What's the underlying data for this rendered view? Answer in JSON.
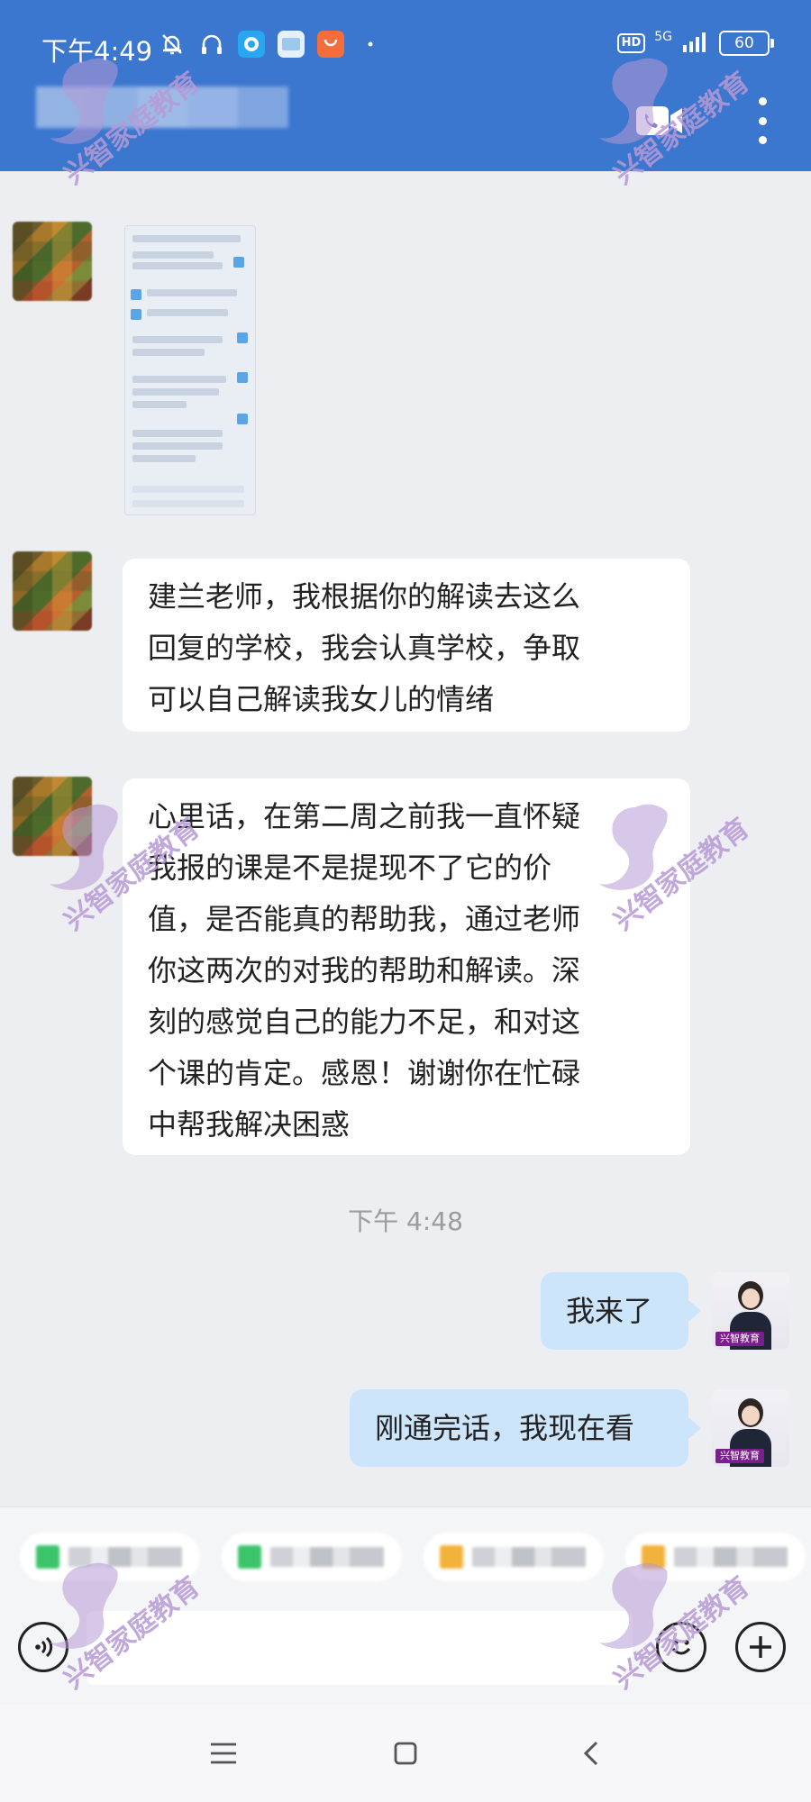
{
  "status_bar": {
    "time": "下午4:49",
    "hd": "HD",
    "network": "5G",
    "battery": "60"
  },
  "colors": {
    "header": "#3b76cf",
    "my_bubble": "#cde5fb",
    "watermark": "#b79ad6"
  },
  "messages": [
    {
      "text": "建兰老师，我根据你的解读去这么\n回复的学校，我会认真学校，争取\n可以自己解读我女儿的情绪"
    },
    {
      "text": "心里话，在第二周之前我一直怀疑\n我报的课是不是提现不了它的价\n值，是否能真的帮助我，通过老师\n你这两次的对我的帮助和解读。深\n刻的感觉自己的能力不足，和对这\n个课的肯定。感恩！谢谢你在忙碌\n中帮我解决困惑"
    }
  ],
  "timestamp": "下午 4:48",
  "my_messages": [
    {
      "text": "我来了"
    },
    {
      "text": "刚通完话，我现在看"
    }
  ],
  "my_avatar_tag": "兴智教育",
  "watermark_text": "兴智家庭教育"
}
